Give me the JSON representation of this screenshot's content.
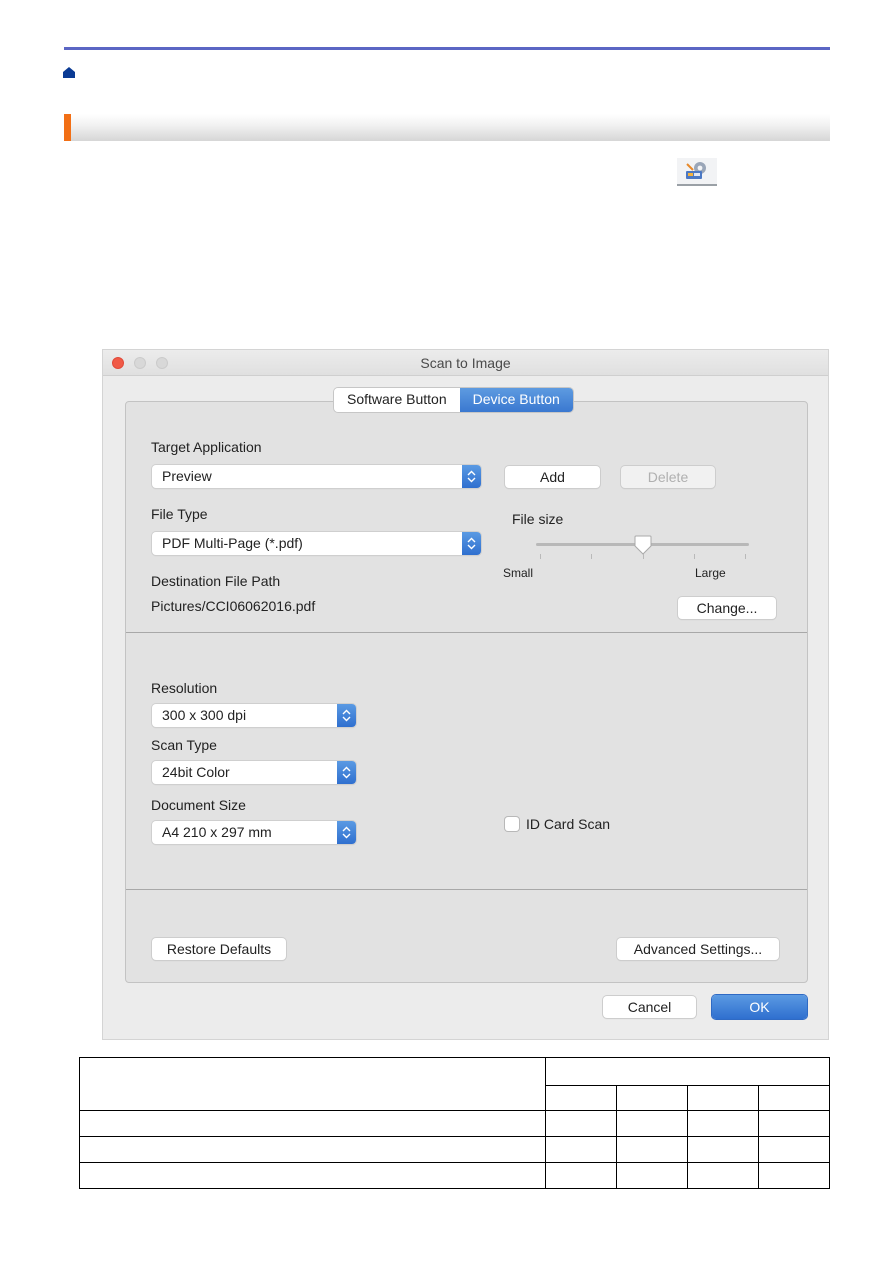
{
  "page": {
    "icons": {
      "home": "home-icon",
      "scan_button": "scan-settings-icon"
    }
  },
  "dialog": {
    "title": "Scan to Image",
    "tabs": [
      {
        "label": "Software Button",
        "selected": false
      },
      {
        "label": "Device Button",
        "selected": true
      }
    ],
    "target_application": {
      "label": "Target Application",
      "value": "Preview",
      "add_label": "Add",
      "delete_label": "Delete",
      "delete_enabled": false
    },
    "file_type": {
      "label": "File Type",
      "value": "PDF Multi-Page (*.pdf)"
    },
    "file_size": {
      "label": "File size",
      "min_label": "Small",
      "max_label": "Large",
      "ticks": 5,
      "position": 0.5
    },
    "destination": {
      "label": "Destination File Path",
      "value": "Pictures/CCI06062016.pdf",
      "change_label": "Change..."
    },
    "resolution": {
      "label": "Resolution",
      "value": "300 x 300 dpi"
    },
    "scan_type": {
      "label": "Scan Type",
      "value": "24bit Color"
    },
    "document_size": {
      "label": "Document Size",
      "value": "A4 210 x 297 mm"
    },
    "id_card_scan": {
      "label": "ID Card Scan",
      "checked": false
    },
    "restore_defaults_label": "Restore Defaults",
    "advanced_settings_label": "Advanced Settings...",
    "cancel_label": "Cancel",
    "ok_label": "OK"
  },
  "table": {
    "header_rows": 2,
    "body_rows": 3,
    "columns": 5,
    "cells": []
  }
}
